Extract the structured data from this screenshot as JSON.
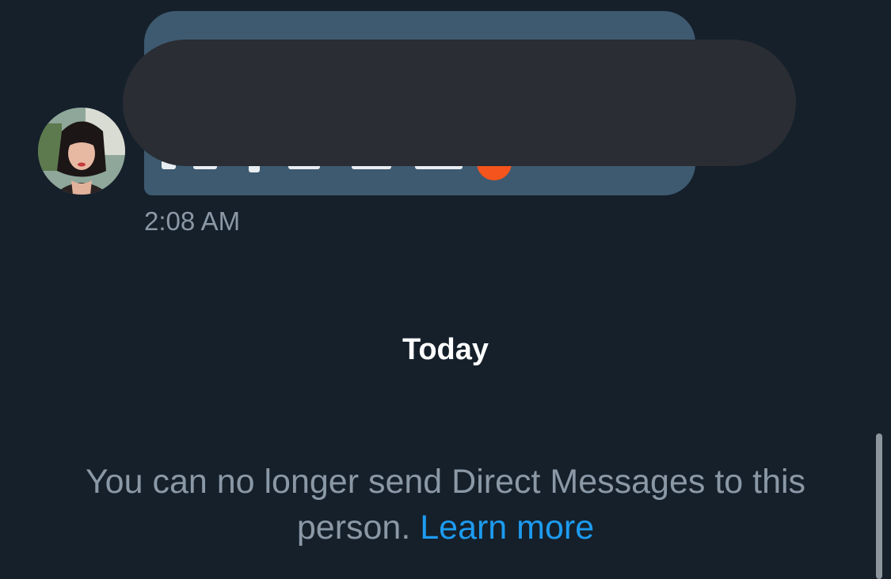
{
  "conversation": {
    "message": {
      "timestamp": "2:08 AM",
      "bubble_color": "#3e5a70",
      "emoji_color": "#f5541d",
      "redaction_color": "#2a2d33"
    },
    "day_divider": "Today",
    "notice": {
      "text": "You can no longer send Direct Messages to this person.",
      "link": "Learn more",
      "link_color": "#1d9bf0"
    }
  },
  "theme": {
    "background": "#15202b",
    "secondary_text": "#8b98a5",
    "primary_text": "#ffffff"
  }
}
